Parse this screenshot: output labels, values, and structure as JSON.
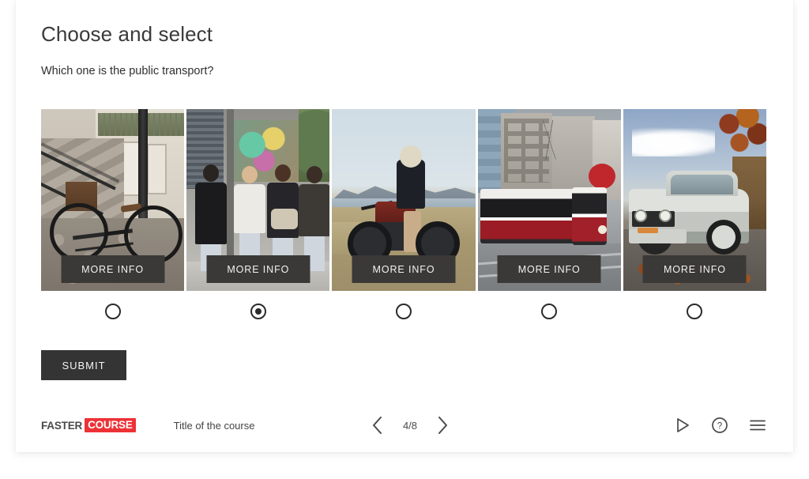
{
  "slide": {
    "title": "Choose and select",
    "question": "Which one is the public transport?",
    "submit_label": "SUBMIT",
    "more_info_label": "MORE INFO"
  },
  "options": [
    {
      "index": 1,
      "photo": "bicycle-against-stairs",
      "more_info_label": "MORE INFO",
      "selected": false
    },
    {
      "index": 2,
      "photo": "pedestrians-on-street",
      "more_info_label": "MORE INFO",
      "selected": true
    },
    {
      "index": 3,
      "photo": "rider-on-motorcycle",
      "more_info_label": "MORE INFO",
      "selected": false
    },
    {
      "index": 4,
      "photo": "red-white-streetcar-tram",
      "more_info_label": "MORE INFO",
      "selected": false
    },
    {
      "index": 5,
      "photo": "silver-car-on-autumn-road",
      "more_info_label": "MORE INFO",
      "selected": false
    }
  ],
  "footer": {
    "logo": {
      "word_one": "FASTER",
      "word_two": "COURSE",
      "badge_color": "#ed3237"
    },
    "course_title": "Title of the course",
    "pager": {
      "prev_icon": "chevron-left-icon",
      "count": "4/8",
      "next_icon": "chevron-right-icon"
    },
    "icons": [
      {
        "name": "play-icon"
      },
      {
        "name": "help-icon"
      },
      {
        "name": "menu-icon"
      }
    ]
  },
  "colors": {
    "accent_red": "#ed3237",
    "dark_button": "#343434",
    "more_info_button": "#3b3937",
    "title_text": "#3a3a3a",
    "body_text": "#2f2f2f"
  }
}
